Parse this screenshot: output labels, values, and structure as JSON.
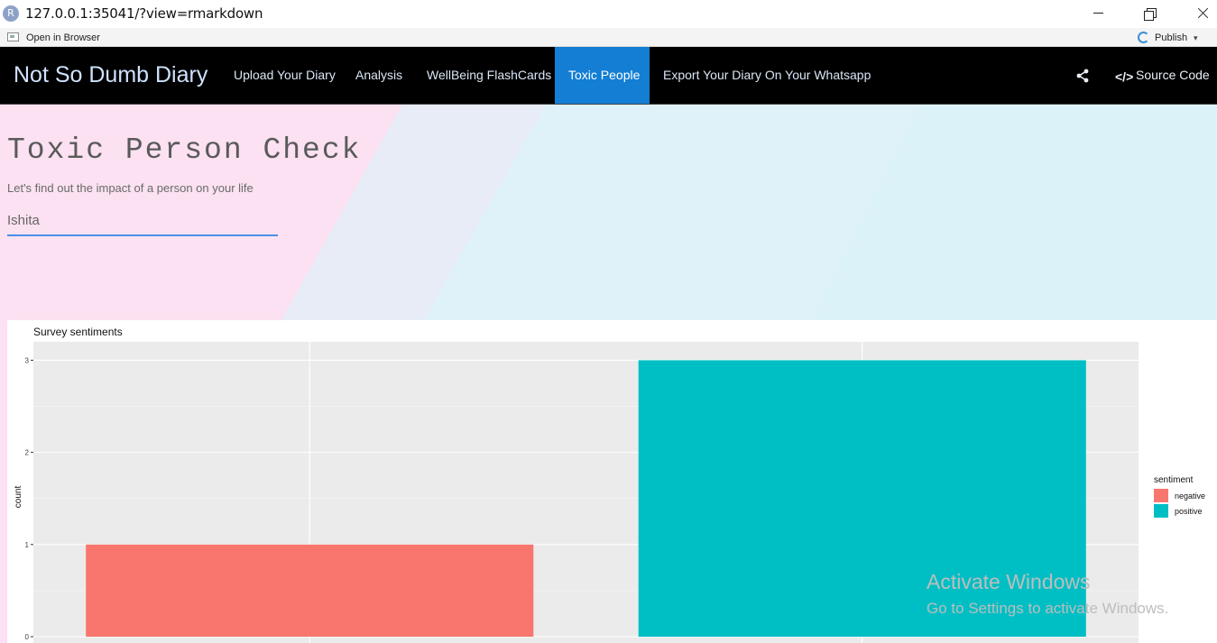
{
  "window": {
    "url": "127.0.0.1:35041/?view=rmarkdown",
    "app_icon": "R"
  },
  "viewer_toolbar": {
    "open_in_browser": "Open in Browser",
    "publish": "Publish"
  },
  "navbar": {
    "brand": "Not So Dumb Diary",
    "items": [
      {
        "label": "Upload Your Diary"
      },
      {
        "label": "Analysis"
      },
      {
        "label": "WellBeing FlashCards"
      },
      {
        "label": "Toxic People",
        "active": true
      },
      {
        "label": "Export Your Diary On Your Whatsapp"
      }
    ],
    "source_code": "Source Code",
    "active_color": "#137ed3"
  },
  "page": {
    "title": "Toxic Person Check",
    "subtitle": "Let's find out the impact of a person on your life",
    "name_input_value": "Ishita"
  },
  "chart_data": {
    "type": "bar",
    "title": "Survey sentiments",
    "xlabel": "",
    "ylabel": "count",
    "categories": [
      "negative",
      "positive"
    ],
    "values": [
      1,
      3
    ],
    "colors": [
      "#f8766d",
      "#00bfc4"
    ],
    "ylim": [
      0,
      3.2
    ],
    "yticks": [
      0,
      1,
      2,
      3
    ],
    "legend": {
      "title": "sentiment",
      "entries": [
        "negative",
        "positive"
      ],
      "placement": "right"
    },
    "grid": true,
    "panel_background": "#ebebeb"
  },
  "watermark": {
    "line1": "Activate Windows",
    "line2": "Go to Settings to activate Windows."
  }
}
